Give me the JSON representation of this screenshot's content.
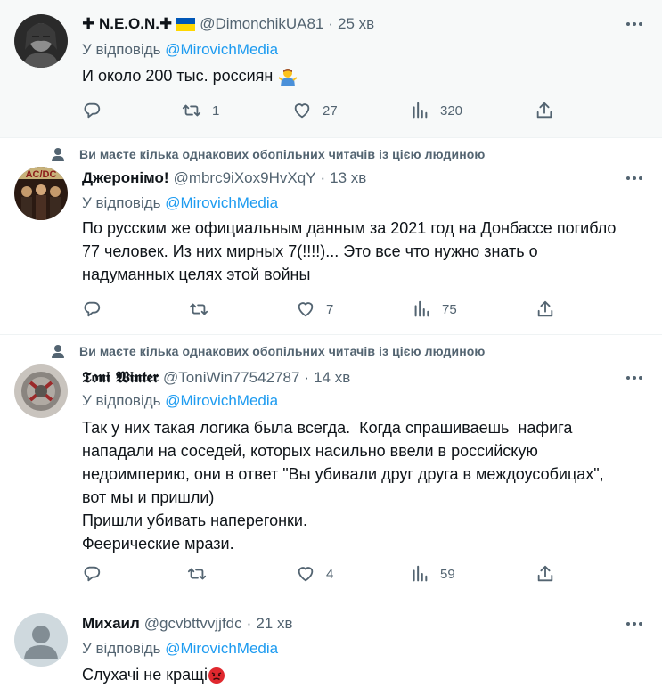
{
  "tweets": [
    {
      "context": "",
      "name": "✚ N.E.O.N.✚",
      "handle": "@DimonchikUA81",
      "dot": "·",
      "time": "25 хв",
      "reply_prefix": "У відповідь",
      "reply_to": "@MirovichMedia",
      "text_lines": [
        "И около 200 тыс. россиян"
      ],
      "replies": "",
      "retweets": "1",
      "likes": "27",
      "views": "320",
      "has_flag": true
    },
    {
      "context": "Ви маєте кілька однакових обопільних читачів із цією людиною",
      "name": "Джеронімо!",
      "handle": "@mbrc9iXox9HvXqY",
      "dot": "·",
      "time": "13 хв",
      "reply_prefix": "У відповідь",
      "reply_to": "@MirovichMedia",
      "text_lines": [
        "По русским же официальным данным за 2021 год на Донбассе погибло",
        "77 человек. Из них мирных 7(!!!!)... Это все что нужно знать о",
        "надуманных целях этой войны"
      ],
      "replies": "",
      "retweets": "",
      "likes": "7",
      "views": "75"
    },
    {
      "context": "Ви маєте кілька однакових обопільних читачів із цією людиною",
      "name": "𝕿𝖔𝖓𝖎 𝖂𝖎𝖓𝖙𝖊𝖗",
      "handle": "@ToniWin77542787",
      "dot": "·",
      "time": "14 хв",
      "reply_prefix": "У відповідь",
      "reply_to": "@MirovichMedia",
      "text_lines": [
        "Так у них такая логика была всегда.  Когда спрашиваешь  нафига",
        "нападали на соседей, которых насильно ввели в российскую",
        "недоимперию, они в ответ \"Вы убивали друг друга в междоусобицах\",",
        "вот мы и пришли)",
        "Пришли убивать наперегонки.",
        "Феерические мрази."
      ],
      "replies": "",
      "retweets": "",
      "likes": "4",
      "views": "59"
    },
    {
      "context": "",
      "name": "Михаил",
      "handle": "@gcvbttvvjjfdc",
      "dot": "·",
      "time": "21 хв",
      "reply_prefix": "У відповідь",
      "reply_to": "@MirovichMedia",
      "text_lines": [
        "Слухачі не кращі"
      ]
    }
  ],
  "colors": {
    "link": "#1d9bf0",
    "secondary": "#536471",
    "text": "#0f1419",
    "highlight_bg": "#f7f9f9",
    "divider": "#eff3f4"
  },
  "icons": [
    "reply-icon",
    "retweet-icon",
    "like-icon",
    "views-icon",
    "share-icon",
    "more-icon",
    "person-icon"
  ]
}
